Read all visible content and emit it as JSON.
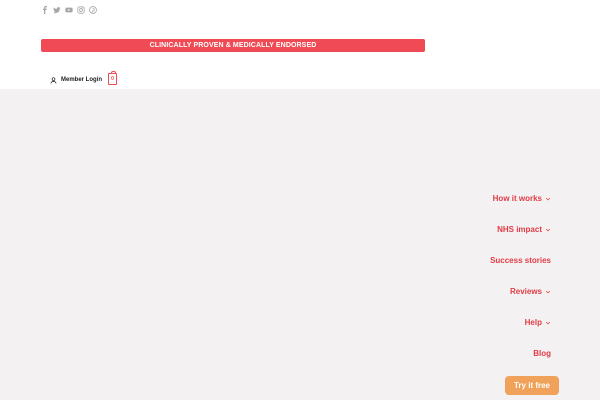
{
  "banner": {
    "text": "CLINICALLY PROVEN & MEDICALLY ENDORSED"
  },
  "social": [
    "facebook-icon",
    "twitter-icon",
    "youtube-icon",
    "instagram-icon",
    "pinterest-icon"
  ],
  "account": {
    "login_label": "Member Login",
    "cart_count": "0"
  },
  "nav": {
    "items": [
      {
        "label": "How it works",
        "has_dropdown": true
      },
      {
        "label": "NHS impact",
        "has_dropdown": true
      },
      {
        "label": "Success stories",
        "has_dropdown": false
      },
      {
        "label": "Reviews",
        "has_dropdown": true
      },
      {
        "label": "Help",
        "has_dropdown": true
      },
      {
        "label": "Blog",
        "has_dropdown": false
      }
    ],
    "cta_label": "Try it free"
  },
  "colors": {
    "accent": "#f04b55",
    "nav_text": "#e23b46",
    "cta": "#f0a15a",
    "background": "#f3f1f1"
  }
}
